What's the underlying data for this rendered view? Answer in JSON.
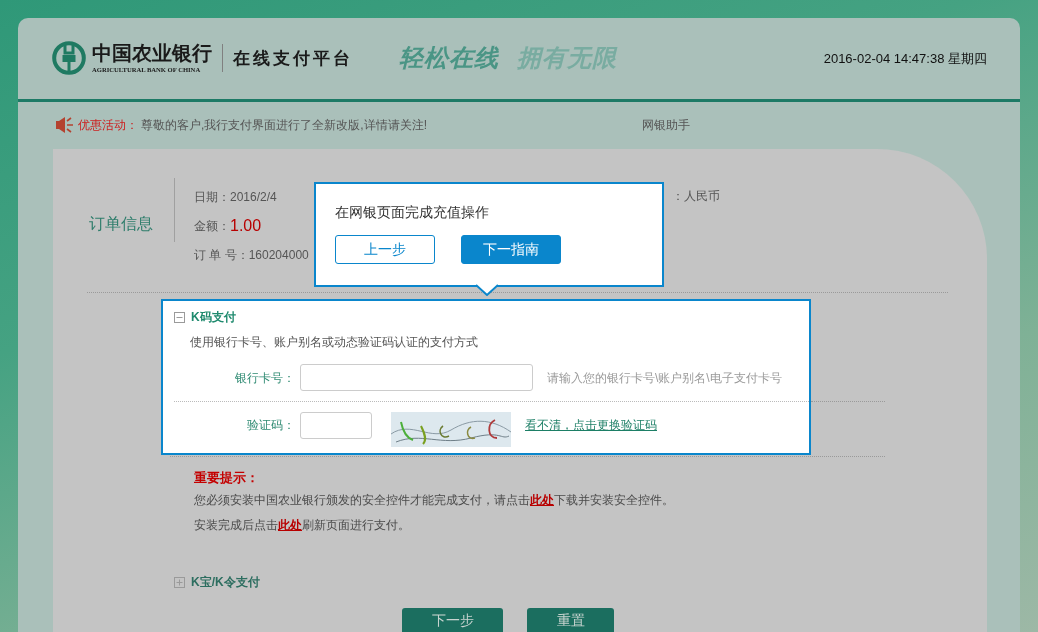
{
  "header": {
    "bank_name": "中国农业银行",
    "bank_name_en": "AGRICULTURAL BANK OF CHINA",
    "platform": "在线支付平台",
    "slogan": [
      "轻松在线",
      "拥有无限"
    ],
    "datetime": "2016-02-04 14:47:38 星期四"
  },
  "announcement": {
    "label": "优惠活动：",
    "message": "尊敬的客户,我行支付界面进行了全新改版,详情请关注!",
    "helper_link": "网银助手"
  },
  "order_info": {
    "title": "订单信息",
    "fields": [
      {
        "kind": "text",
        "label": "日期：",
        "value": "2016/2/4"
      },
      {
        "kind": "amount",
        "label": "金额：",
        "value": "1.00"
      },
      {
        "kind": "text",
        "label": "订 单 号：",
        "value": "160204000"
      }
    ],
    "currency": "：人民币"
  },
  "payment_methods": [
    {
      "title": "K码支付",
      "expanded": true,
      "highlighted": true,
      "description": "使用银行卡号、账户别名或动态验证码认证的支付方式",
      "fields": [
        {
          "kind": "card",
          "label": "银行卡号：",
          "hint": "请输入您的银行卡号\\账户别名\\电子支付卡号"
        },
        {
          "kind": "captcha",
          "label": "验证码：",
          "refresh_link": "看不清，点击更换验证码"
        }
      ],
      "security_notice": {
        "title": "重要提示：",
        "lines": [
          {
            "before": "您必须安装中国农业银行颁发的安全控件才能完成支付，请点击",
            "link": "此处",
            "after": "下载并安装安全控件。"
          },
          {
            "before": "安装完成后点击",
            "link": "此处",
            "after": "刷新页面进行支付。"
          }
        ]
      }
    },
    {
      "title": "K宝/K令支付",
      "expanded": false,
      "highlighted": false
    }
  ],
  "actions": [
    "下一步",
    "重置"
  ],
  "guide_popup": {
    "message": "在网银页面完成充值操作",
    "buttons": [
      {
        "kind": "secondary",
        "label": "上一步"
      },
      {
        "kind": "primary",
        "label": "下一指南"
      }
    ]
  }
}
